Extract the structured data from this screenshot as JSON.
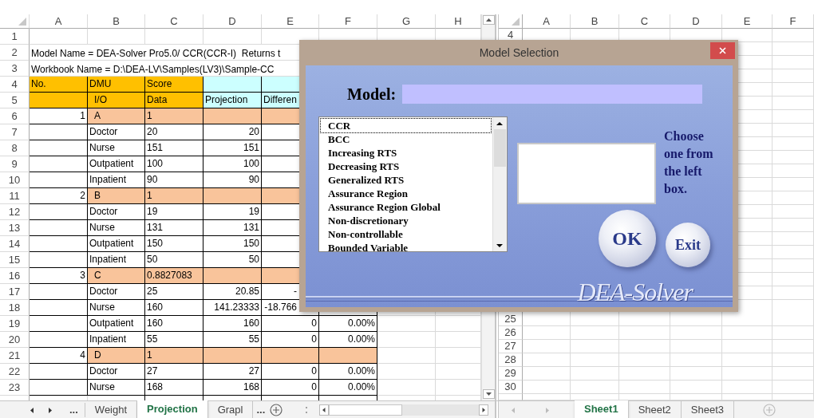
{
  "left_sheet": {
    "columns": [
      "A",
      "B",
      "C",
      "D",
      "E",
      "F",
      "G",
      "H"
    ],
    "rows": [
      {
        "number": "1",
        "kind": "plain",
        "cells": []
      },
      {
        "number": "2",
        "kind": "note",
        "text": "Model Name = DEA-Solver Pro5.0/ CCR(CCR-I)  Returns t"
      },
      {
        "number": "3",
        "kind": "note",
        "text": "Workbook Name = D:\\DEA-LV\\Samples(LV3)\\Sample-CC"
      },
      {
        "number": "4",
        "kind": "header",
        "cells": [
          "No.",
          "DMU",
          "Score",
          "",
          ""
        ]
      },
      {
        "number": "5",
        "kind": "header",
        "cells": [
          "",
          "I/O",
          "Data",
          "Projection",
          "Differen"
        ]
      },
      {
        "number": "6",
        "kind": "dmu",
        "cells": [
          "1",
          "A",
          "1",
          "",
          ""
        ]
      },
      {
        "number": "7",
        "kind": "item",
        "cells": [
          "",
          "Doctor",
          "20",
          "20",
          ""
        ]
      },
      {
        "number": "8",
        "kind": "item",
        "cells": [
          "",
          "Nurse",
          "151",
          "151",
          ""
        ]
      },
      {
        "number": "9",
        "kind": "item",
        "cells": [
          "",
          "Outpatient",
          "100",
          "100",
          ""
        ]
      },
      {
        "number": "10",
        "kind": "item",
        "cells": [
          "",
          "Inpatient",
          "90",
          "90",
          ""
        ]
      },
      {
        "number": "11",
        "kind": "dmu",
        "cells": [
          "2",
          "B",
          "1",
          "",
          ""
        ]
      },
      {
        "number": "12",
        "kind": "item",
        "cells": [
          "",
          "Doctor",
          "19",
          "19",
          ""
        ]
      },
      {
        "number": "13",
        "kind": "item",
        "cells": [
          "",
          "Nurse",
          "131",
          "131",
          ""
        ]
      },
      {
        "number": "14",
        "kind": "item",
        "cells": [
          "",
          "Outpatient",
          "150",
          "150",
          ""
        ]
      },
      {
        "number": "15",
        "kind": "item",
        "cells": [
          "",
          "Inpatient",
          "50",
          "50",
          ""
        ]
      },
      {
        "number": "16",
        "kind": "dmu",
        "cells": [
          "3",
          "C",
          "0.8827083",
          "",
          ""
        ]
      },
      {
        "number": "17",
        "kind": "item",
        "cells": [
          "",
          "Doctor",
          "25",
          "20.85",
          {
            "text": "-",
            "cut": true
          }
        ]
      },
      {
        "number": "18",
        "kind": "item",
        "cells": [
          "",
          "Nurse",
          "160",
          "141.23333",
          {
            "text": "-18.766",
            "cut": true
          }
        ]
      },
      {
        "number": "19",
        "kind": "item",
        "cells": [
          "",
          "Outpatient",
          "160",
          "160",
          "0",
          "0.00%"
        ]
      },
      {
        "number": "20",
        "kind": "item",
        "cells": [
          "",
          "Inpatient",
          "55",
          "55",
          "0",
          "0.00%"
        ]
      },
      {
        "number": "21",
        "kind": "dmu",
        "cells": [
          "4",
          "D",
          "1",
          "",
          "",
          ""
        ]
      },
      {
        "number": "22",
        "kind": "item",
        "cells": [
          "",
          "Doctor",
          "27",
          "27",
          "0",
          "0.00%"
        ]
      },
      {
        "number": "23",
        "kind": "item",
        "cells": [
          "",
          "Nurse",
          "168",
          "168",
          "0",
          "0.00%"
        ]
      }
    ]
  },
  "right_sheet": {
    "columns": [
      "A",
      "B",
      "C",
      "D",
      "E",
      "F"
    ],
    "top_rows": [
      "4"
    ],
    "bottom_rows": [
      "25",
      "26",
      "27",
      "28",
      "29",
      "30"
    ]
  },
  "left_tab_bar": {
    "more_before": "...",
    "tabs": [
      {
        "label": "Weight",
        "selected": false
      },
      {
        "label": "Projection",
        "selected": true
      },
      {
        "label": "Grapl",
        "selected": false
      }
    ],
    "more_after": "..."
  },
  "right_tab_bar": {
    "tabs": [
      {
        "label": "Sheet1",
        "selected": true
      },
      {
        "label": "Sheet2",
        "selected": false
      },
      {
        "label": "Sheet3",
        "selected": false
      }
    ]
  },
  "dialog": {
    "title": "Model Selection",
    "model_label": "Model:",
    "models": [
      {
        "label": "CCR",
        "selected": true
      },
      {
        "label": "BCC",
        "selected": false
      },
      {
        "label": "Increasing RTS",
        "selected": false
      },
      {
        "label": "Decreasing RTS",
        "selected": false
      },
      {
        "label": "Generalized RTS",
        "selected": false
      },
      {
        "label": "Assurance Region",
        "selected": false
      },
      {
        "label": "Assurance Region Global",
        "selected": false
      },
      {
        "label": "Non-discretionary",
        "selected": false
      },
      {
        "label": "Non-controllable",
        "selected": false
      },
      {
        "label": "Bounded Variable",
        "selected": false
      }
    ],
    "hint": "Choose one from the left box.",
    "buttons": [
      {
        "label": "OK",
        "kind": "large"
      },
      {
        "label": "Exit",
        "kind": "small"
      }
    ],
    "logo": "DEA-Solver"
  }
}
